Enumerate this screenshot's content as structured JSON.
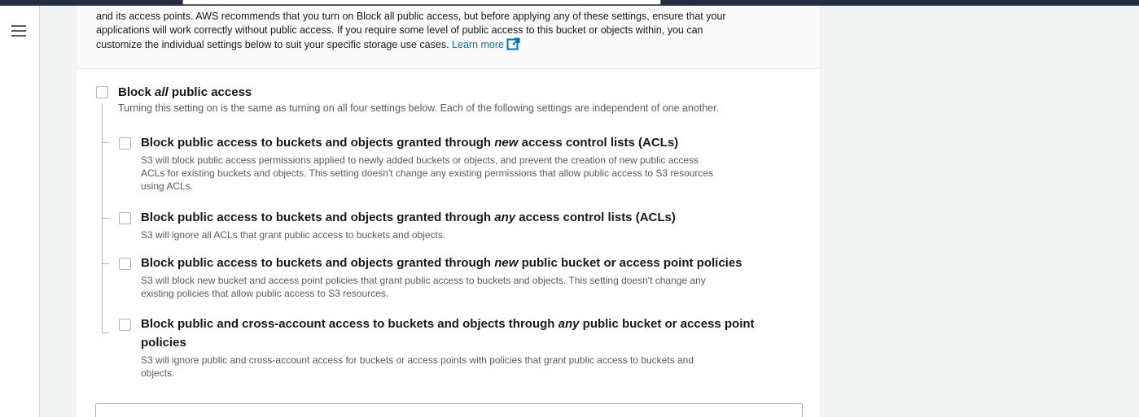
{
  "colors": {
    "topbar": "#232f3e",
    "link": "#0073bb",
    "text": "#16191f",
    "secondary_text": "#545b64",
    "border": "#aab7b8"
  },
  "intro": {
    "text_line1": "and its access points. AWS recommends that you turn on Block all public access, but before applying any of these settings, ensure that your",
    "text_line2": "applications will work correctly without public access. If you require some level of public access to this bucket or objects within, you can",
    "text_line3": "customize the individual settings below to suit your specific storage use cases.",
    "learn_more": "Learn more",
    "learn_more_icon": "external-link-icon"
  },
  "block_all": {
    "title_pre": "Block ",
    "title_em": "all",
    "title_post": " public access",
    "description": "Turning this setting on is the same as turning on all four settings below. Each of the following settings are independent of one another.",
    "checked": false
  },
  "options": [
    {
      "title_pre": "Block public access to buckets and objects granted through ",
      "title_em": "new",
      "title_post": " access control lists (ACLs)",
      "desc_line1": "S3 will block public access permissions applied to newly added buckets or objects, and prevent the creation of new public access",
      "desc_line2": "ACLs for existing buckets and objects. This setting doesn't change any existing permissions that allow public access to S3 resources",
      "desc_line3": "using ACLs.",
      "checked": false
    },
    {
      "title_pre": "Block public access to buckets and objects granted through ",
      "title_em": "any",
      "title_post": " access control lists (ACLs)",
      "desc_line1": "S3 will ignore all ACLs that grant public access to buckets and objects.",
      "checked": false
    },
    {
      "title_pre": "Block public access to buckets and objects granted through ",
      "title_em": "new",
      "title_post": " public bucket or access point policies",
      "desc_line1": "S3 will block new bucket and access point policies that grant public access to buckets and objects. This setting doesn't change any",
      "desc_line2": "existing policies that allow public access to S3 resources.",
      "checked": false
    },
    {
      "title_pre": "Block public and cross-account access to buckets and objects through ",
      "title_em": "any",
      "title_post": " public bucket or access point",
      "title_line2": "policies",
      "desc_line1": "S3 will ignore public and cross-account access for buckets or access points with policies that grant public access to buckets and",
      "desc_line2": "objects.",
      "checked": false
    }
  ],
  "nav": {
    "menu_icon": "hamburger-menu-icon"
  }
}
